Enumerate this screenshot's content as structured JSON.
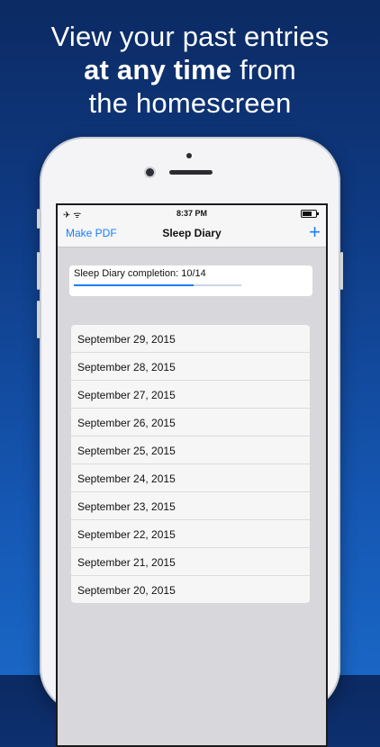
{
  "headline": {
    "line1": "View your past entries",
    "line2_bold": "at any time",
    "line2_rest": " from",
    "line3": "the homescreen"
  },
  "status_bar": {
    "time": "8:37 PM",
    "left_icons": "✈ ᯤ"
  },
  "nav": {
    "left_button": "Make PDF",
    "title": "Sleep Diary",
    "add_icon": "+"
  },
  "progress": {
    "label": "Sleep Diary completion: 10/14",
    "fraction": 0.714
  },
  "entries": [
    "September 29, 2015",
    "September 28, 2015",
    "September 27, 2015",
    "September 26, 2015",
    "September 25, 2015",
    "September 24, 2015",
    "September 23, 2015",
    "September 22, 2015",
    "September 21, 2015",
    "September 20, 2015"
  ]
}
